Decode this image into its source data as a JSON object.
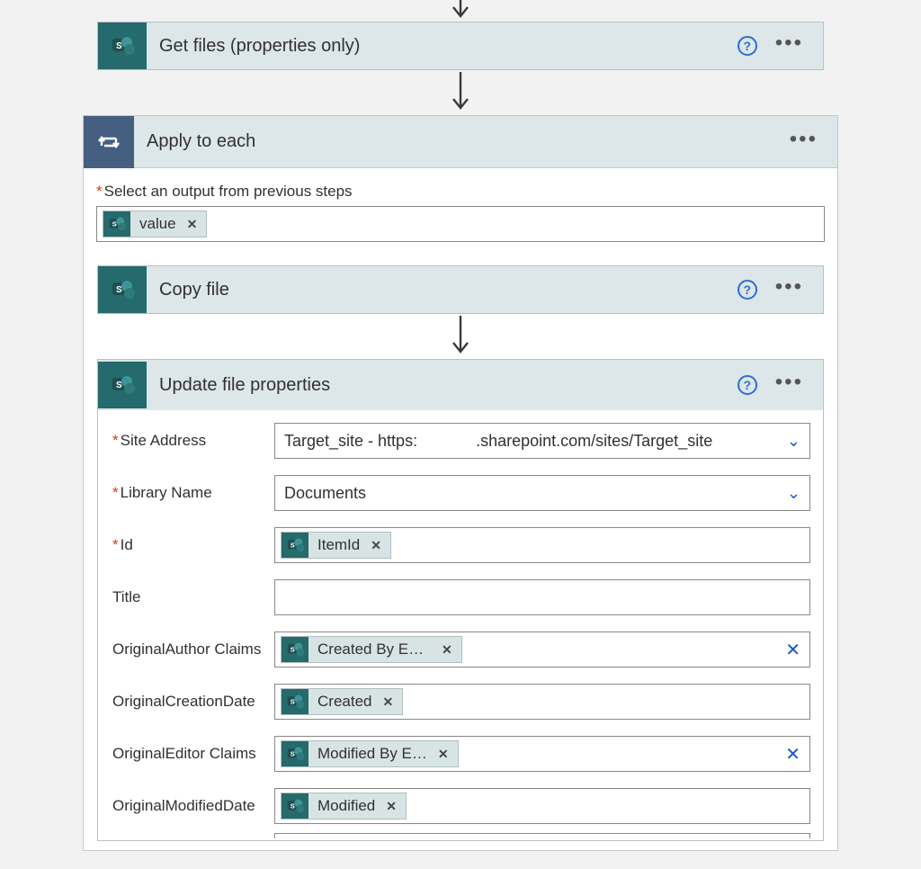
{
  "getFiles": {
    "title": "Get files (properties only)"
  },
  "foreach": {
    "title": "Apply to each",
    "selectLabel": "Select an output from previous steps",
    "token": "value"
  },
  "copyFile": {
    "title": "Copy file"
  },
  "updateFile": {
    "title": "Update file properties",
    "fields": {
      "siteAddress": {
        "label": "Site Address",
        "value": "Target_site - https:             .sharepoint.com/sites/Target_site"
      },
      "libraryName": {
        "label": "Library Name",
        "value": "Documents"
      },
      "id": {
        "label": "Id",
        "token": "ItemId"
      },
      "title": {
        "label": "Title"
      },
      "originalAuthor": {
        "label": "OriginalAuthor Claims",
        "token": "Created By Em…"
      },
      "originalCreationDate": {
        "label": "OriginalCreationDate",
        "token": "Created"
      },
      "originalEditor": {
        "label": "OriginalEditor Claims",
        "token": "Modified By E…"
      },
      "originalModifiedDate": {
        "label": "OriginalModifiedDate",
        "token": "Modified"
      }
    }
  },
  "ui": {
    "help": "?",
    "close": "✕"
  }
}
